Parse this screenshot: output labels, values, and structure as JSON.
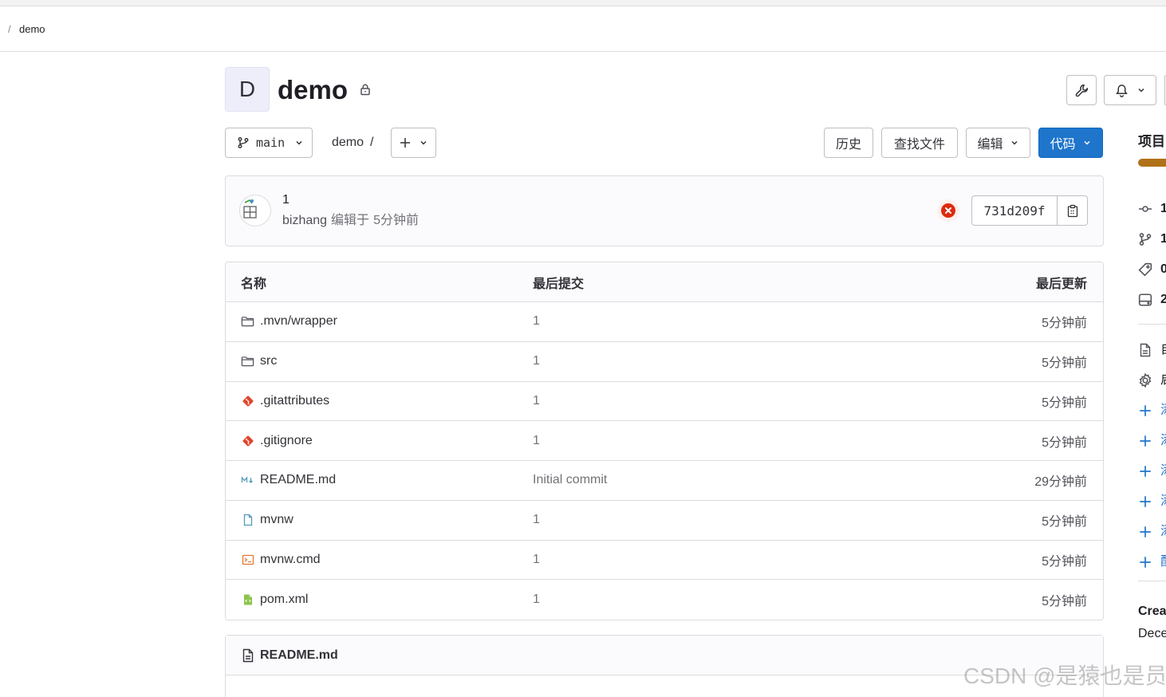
{
  "breadcrumb": {
    "separator": "/",
    "current": "demo"
  },
  "project": {
    "avatar_letter": "D",
    "name": "demo",
    "visibility_icon": "lock-icon"
  },
  "header_actions": {
    "settings_icon": "wrench-icon",
    "notifications_icon": "bell-icon",
    "dropdown_icon": "chevron-down-icon"
  },
  "toolbar": {
    "branch_icon": "branch-icon",
    "branch": "main",
    "path_root": "demo",
    "path_separator": "/",
    "add_icon": "plus-icon",
    "history": "历史",
    "find_file": "查找文件",
    "edit": "编辑",
    "code": "代码"
  },
  "last_commit": {
    "title": "1",
    "author": "bizhang",
    "action": "编辑于",
    "time": "5分钟前",
    "pipeline_icon": "status-failed-icon",
    "sha": "731d209f",
    "copy_icon": "copy-icon"
  },
  "files_table": {
    "columns": {
      "name": "名称",
      "last_commit": "最后提交",
      "last_update": "最后更新"
    },
    "rows": [
      {
        "icon": "folder-icon",
        "name": ".mvn/wrapper",
        "commit": "1",
        "updated": "5分钟前"
      },
      {
        "icon": "folder-icon",
        "name": "src",
        "commit": "1",
        "updated": "5分钟前"
      },
      {
        "icon": "git-file-icon",
        "name": ".gitattributes",
        "commit": "1",
        "updated": "5分钟前"
      },
      {
        "icon": "git-file-icon",
        "name": ".gitignore",
        "commit": "1",
        "updated": "5分钟前"
      },
      {
        "icon": "markdown-file-icon",
        "name": "README.md",
        "commit": "Initial commit",
        "updated": "29分钟前"
      },
      {
        "icon": "file-icon",
        "name": "mvnw",
        "commit": "1",
        "updated": "5分钟前"
      },
      {
        "icon": "console-file-icon",
        "name": "mvnw.cmd",
        "commit": "1",
        "updated": "5分钟前"
      },
      {
        "icon": "xml-file-icon",
        "name": "pom.xml",
        "commit": "1",
        "updated": "5分钟前"
      }
    ]
  },
  "readme": {
    "icon": "doc-icon",
    "title": "README.md"
  },
  "sidebar": {
    "title": "项目",
    "stats": [
      {
        "icon": "commit-icon",
        "value": "1"
      },
      {
        "icon": "branch-icon",
        "value": "1"
      },
      {
        "icon": "tag-icon",
        "value": "0"
      },
      {
        "icon": "storage-icon",
        "value": "2"
      }
    ],
    "links": [
      {
        "icon": "doc-icon",
        "label": "自"
      },
      {
        "icon": "gear-icon",
        "label": "启"
      },
      {
        "icon": "plus-icon",
        "label": "添"
      },
      {
        "icon": "plus-icon",
        "label": "添"
      },
      {
        "icon": "plus-icon",
        "label": "添"
      },
      {
        "icon": "plus-icon",
        "label": "添"
      },
      {
        "icon": "plus-icon",
        "label": "添"
      },
      {
        "icon": "plus-icon",
        "label": "配"
      }
    ],
    "created_label": "Crea",
    "created_date": "Dece"
  },
  "watermark": "CSDN @是猿也是员",
  "colors": {
    "primary": "#1f75cb",
    "danger": "#dd2b0e",
    "border": "#dcdcde",
    "language_bar": "#b07219",
    "text": "#333238",
    "muted": "#737278"
  }
}
